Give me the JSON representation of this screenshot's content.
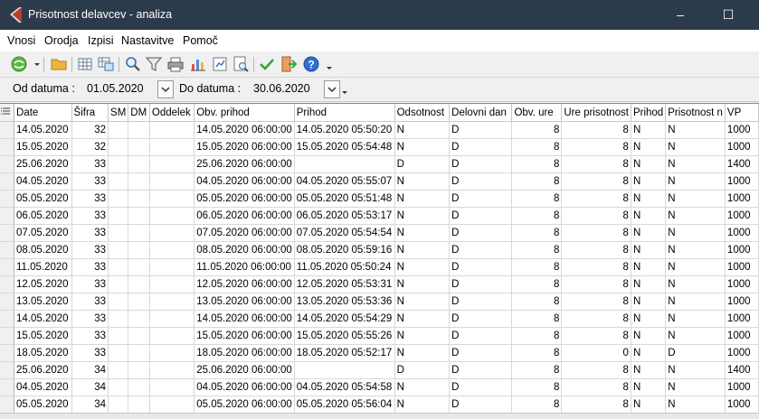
{
  "window": {
    "title": "Prisotnost delavcev - analiza",
    "minimize": "–",
    "maximize": "☐"
  },
  "menu": [
    "Vnosi",
    "Orodja",
    "Izpisi",
    "Nastavitve",
    "Pomoč"
  ],
  "toolbar_icons": [
    "green-globe-icon",
    "dropdown-arrow-icon",
    "folder-icon",
    "grid-icon",
    "grid-export-icon",
    "search-icon",
    "filter-icon",
    "printer-icon",
    "bar-chart-icon",
    "report-icon",
    "preview-icon",
    "checkmark-icon",
    "exit-icon",
    "help-icon",
    "more-icon"
  ],
  "datebar": {
    "from_label": "Od datuma :",
    "from_value": "01.05.2020",
    "to_label": "Do datuma :",
    "to_value": "30.06.2020"
  },
  "columns": [
    "Date",
    "Šifra",
    "SM",
    "DM",
    "Oddelek",
    "Obv. prihod",
    "Prihod",
    "Odsotnost",
    "Delovni dan",
    "Obv. ure",
    "Ure prisotnost",
    "Prihod",
    "Prisotnost n",
    "VP"
  ],
  "rows": [
    [
      "14.05.2020",
      "32",
      "",
      "",
      "",
      "14.05.2020 06:00:00",
      "14.05.2020 05:50:20",
      "N",
      "D",
      "8",
      "8",
      "N",
      "N",
      "1000"
    ],
    [
      "15.05.2020",
      "32",
      "",
      "",
      "",
      "15.05.2020 06:00:00",
      "15.05.2020 05:54:48",
      "N",
      "D",
      "8",
      "8",
      "N",
      "N",
      "1000"
    ],
    [
      "25.06.2020",
      "33",
      "",
      "",
      "",
      "25.06.2020 06:00:00",
      "",
      "D",
      "D",
      "8",
      "8",
      "N",
      "N",
      "1400"
    ],
    [
      "04.05.2020",
      "33",
      "",
      "",
      "",
      "04.05.2020 06:00:00",
      "04.05.2020 05:55:07",
      "N",
      "D",
      "8",
      "8",
      "N",
      "N",
      "1000"
    ],
    [
      "05.05.2020",
      "33",
      "",
      "",
      "",
      "05.05.2020 06:00:00",
      "05.05.2020 05:51:48",
      "N",
      "D",
      "8",
      "8",
      "N",
      "N",
      "1000"
    ],
    [
      "06.05.2020",
      "33",
      "",
      "",
      "",
      "06.05.2020 06:00:00",
      "06.05.2020 05:53:17",
      "N",
      "D",
      "8",
      "8",
      "N",
      "N",
      "1000"
    ],
    [
      "07.05.2020",
      "33",
      "",
      "",
      "",
      "07.05.2020 06:00:00",
      "07.05.2020 05:54:54",
      "N",
      "D",
      "8",
      "8",
      "N",
      "N",
      "1000"
    ],
    [
      "08.05.2020",
      "33",
      "",
      "",
      "",
      "08.05.2020 06:00:00",
      "08.05.2020 05:59:16",
      "N",
      "D",
      "8",
      "8",
      "N",
      "N",
      "1000"
    ],
    [
      "11.05.2020",
      "33",
      "",
      "",
      "",
      "11.05.2020 06:00:00",
      "11.05.2020 05:50:24",
      "N",
      "D",
      "8",
      "8",
      "N",
      "N",
      "1000"
    ],
    [
      "12.05.2020",
      "33",
      "",
      "",
      "",
      "12.05.2020 06:00:00",
      "12.05.2020 05:53:31",
      "N",
      "D",
      "8",
      "8",
      "N",
      "N",
      "1000"
    ],
    [
      "13.05.2020",
      "33",
      "",
      "",
      "",
      "13.05.2020 06:00:00",
      "13.05.2020 05:53:36",
      "N",
      "D",
      "8",
      "8",
      "N",
      "N",
      "1000"
    ],
    [
      "14.05.2020",
      "33",
      "",
      "",
      "",
      "14.05.2020 06:00:00",
      "14.05.2020 05:54:29",
      "N",
      "D",
      "8",
      "8",
      "N",
      "N",
      "1000"
    ],
    [
      "15.05.2020",
      "33",
      "",
      "",
      "",
      "15.05.2020 06:00:00",
      "15.05.2020 05:55:26",
      "N",
      "D",
      "8",
      "8",
      "N",
      "N",
      "1000"
    ],
    [
      "18.05.2020",
      "33",
      "",
      "",
      "",
      "18.05.2020 06:00:00",
      "18.05.2020 05:52:17",
      "N",
      "D",
      "8",
      "0",
      "N",
      "D",
      "1000"
    ],
    [
      "25.06.2020",
      "34",
      "",
      "",
      "",
      "25.06.2020 06:00:00",
      "",
      "D",
      "D",
      "8",
      "8",
      "N",
      "N",
      "1400"
    ],
    [
      "04.05.2020",
      "34",
      "",
      "",
      "",
      "04.05.2020 06:00:00",
      "04.05.2020 05:54:58",
      "N",
      "D",
      "8",
      "8",
      "N",
      "N",
      "1000"
    ],
    [
      "05.05.2020",
      "34",
      "",
      "",
      "",
      "05.05.2020 06:00:00",
      "05.05.2020 05:56:04",
      "N",
      "D",
      "8",
      "8",
      "N",
      "N",
      "1000"
    ]
  ],
  "colors": {
    "titlebar": "#2b3b4c",
    "app_icon_red": "#c0392b"
  }
}
